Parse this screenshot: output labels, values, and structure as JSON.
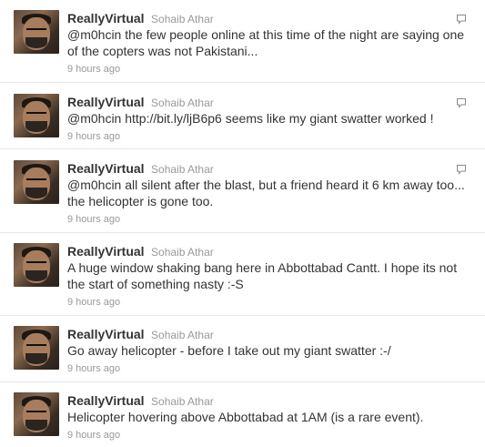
{
  "tweets": [
    {
      "screen_name": "ReallyVirtual",
      "full_name": "Sohaib Athar",
      "mention": "@m0hcin",
      "link": "",
      "text": " the few people online at this time of the night are saying one of the copters was not Pakistani...",
      "timestamp": "9 hours ago",
      "reply_icon": "reply-icon"
    },
    {
      "screen_name": "ReallyVirtual",
      "full_name": "Sohaib Athar",
      "mention": "@m0hcin",
      "link": " http://bit.ly/ljB6p6",
      "text": " seems like my giant swatter worked !",
      "timestamp": "9 hours ago",
      "reply_icon": "reply-icon"
    },
    {
      "screen_name": "ReallyVirtual",
      "full_name": "Sohaib Athar",
      "mention": "@m0hcin",
      "link": "",
      "text": " all silent after the blast, but a friend heard it 6 km away too... the helicopter is gone too.",
      "timestamp": "9 hours ago",
      "reply_icon": "reply-icon"
    },
    {
      "screen_name": "ReallyVirtual",
      "full_name": "Sohaib Athar",
      "mention": "",
      "link": "",
      "text": "A huge window shaking bang here in Abbottabad Cantt. I hope its not the start of something nasty :-S",
      "timestamp": "9 hours ago"
    },
    {
      "screen_name": "ReallyVirtual",
      "full_name": "Sohaib Athar",
      "mention": "",
      "link": "",
      "text": "Go away helicopter - before I take out my giant swatter :-/",
      "timestamp": "9 hours ago"
    },
    {
      "screen_name": "ReallyVirtual",
      "full_name": "Sohaib Athar",
      "mention": "",
      "link": "",
      "text": "Helicopter hovering above Abbottabad at 1AM (is a rare event).",
      "timestamp": "9 hours ago"
    }
  ],
  "colors": {
    "text": "#333333",
    "muted": "#999999",
    "divider": "#e6e6e6"
  }
}
